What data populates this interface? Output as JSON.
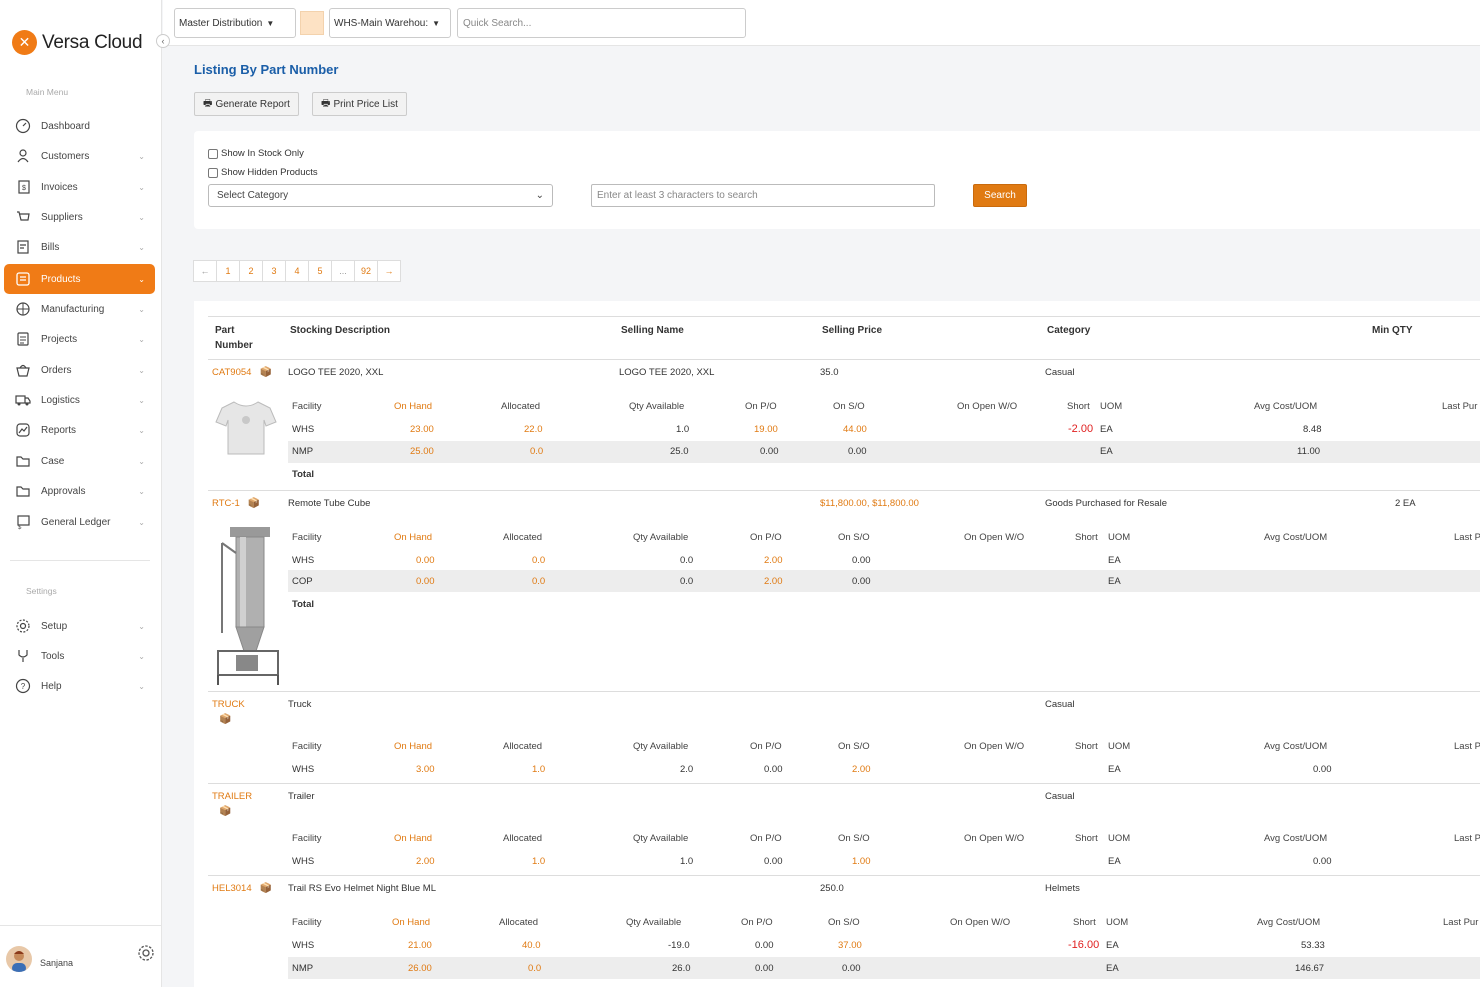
{
  "brand": {
    "name": "Versa Cloud"
  },
  "sidebar": {
    "main_heading": "Main Menu",
    "items": [
      {
        "label": "Dashboard"
      },
      {
        "label": "Customers"
      },
      {
        "label": "Invoices"
      },
      {
        "label": "Suppliers"
      },
      {
        "label": "Bills"
      },
      {
        "label": "Products"
      },
      {
        "label": "Manufacturing"
      },
      {
        "label": "Projects"
      },
      {
        "label": "Orders"
      },
      {
        "label": "Logistics"
      },
      {
        "label": "Reports"
      },
      {
        "label": "Case"
      },
      {
        "label": "Approvals"
      },
      {
        "label": "General Ledger"
      }
    ],
    "settings_heading": "Settings",
    "settings_items": [
      {
        "label": "Setup"
      },
      {
        "label": "Tools"
      },
      {
        "label": "Help"
      }
    ],
    "user": {
      "name": "Sanjana"
    }
  },
  "topbar": {
    "company": "Master Distribution",
    "warehouse": "WHS-Main Warehou:",
    "quick_search_placeholder": "Quick Search..."
  },
  "page": {
    "title": "Listing By Part Number",
    "generate_report": "Generate Report",
    "print_price_list": "Print Price List"
  },
  "filters": {
    "show_in_stock": "Show In Stock Only",
    "show_hidden": "Show Hidden Products",
    "category_placeholder": "Select Category",
    "search_placeholder": "Enter at least 3 characters to search",
    "search_button": "Search"
  },
  "pager": [
    "←",
    "1",
    "2",
    "3",
    "4",
    "5",
    "...",
    "92",
    "→"
  ],
  "columns": {
    "part_number_1": "Part",
    "part_number_2": "Number",
    "stocking_description": "Stocking Description",
    "selling_name": "Selling Name",
    "selling_price": "Selling Price",
    "category": "Category",
    "min_qty": "Min QTY"
  },
  "inv_columns": {
    "facility": "Facility",
    "on_hand": "On Hand",
    "allocated": "Allocated",
    "qty_available": "Qty Available",
    "on_po": "On P/O",
    "on_so": "On S/O",
    "on_open_wo": "On Open W/O",
    "short": "Short",
    "uom": "UOM",
    "avg_cost": "Avg Cost/UOM",
    "last_pur": "Last Pur",
    "last_p": "Last P",
    "total": "Total"
  },
  "products": [
    {
      "part": "CAT9054",
      "desc": "LOGO TEE 2020, XXL",
      "selling_name": "LOGO TEE 2020, XXL",
      "price": "35.0",
      "category": "Casual",
      "min_qty": "",
      "rows": [
        {
          "facility": "WHS",
          "on_hand": "23.00",
          "allocated": "22.0",
          "qty": "1.0",
          "po": "19.00",
          "so": "44.00",
          "short": "-2.00",
          "uom": "EA",
          "avg": "8.48"
        },
        {
          "facility": "NMP",
          "on_hand": "25.00",
          "allocated": "0.0",
          "qty": "25.0",
          "po": "0.00",
          "so": "0.00",
          "short": "",
          "uom": "EA",
          "avg": "11.00"
        }
      ]
    },
    {
      "part": "RTC-1",
      "desc": "Remote Tube Cube",
      "selling_name": "",
      "price": "$11,800.00, $11,800.00",
      "category": "Goods Purchased for Resale",
      "min_qty": "2 EA",
      "rows": [
        {
          "facility": "WHS",
          "on_hand": "0.00",
          "allocated": "0.0",
          "qty": "0.0",
          "po": "2.00",
          "so": "0.00",
          "short": "",
          "uom": "EA",
          "avg": ""
        },
        {
          "facility": "COP",
          "on_hand": "0.00",
          "allocated": "0.0",
          "qty": "0.0",
          "po": "2.00",
          "so": "0.00",
          "short": "",
          "uom": "EA",
          "avg": ""
        }
      ]
    },
    {
      "part": "TRUCK",
      "desc": "Truck",
      "selling_name": "",
      "price": "",
      "category": "Casual",
      "min_qty": "",
      "rows": [
        {
          "facility": "WHS",
          "on_hand": "3.00",
          "allocated": "1.0",
          "qty": "2.0",
          "po": "0.00",
          "so": "2.00",
          "short": "",
          "uom": "EA",
          "avg": "0.00"
        }
      ]
    },
    {
      "part": "TRAILER",
      "desc": "Trailer",
      "selling_name": "",
      "price": "",
      "category": "Casual",
      "min_qty": "",
      "rows": [
        {
          "facility": "WHS",
          "on_hand": "2.00",
          "allocated": "1.0",
          "qty": "1.0",
          "po": "0.00",
          "so": "1.00",
          "short": "",
          "uom": "EA",
          "avg": "0.00"
        }
      ]
    },
    {
      "part": "HEL3014",
      "desc": "Trail RS Evo Helmet Night Blue ML",
      "selling_name": "",
      "price": "250.0",
      "category": "Helmets",
      "min_qty": "",
      "rows": [
        {
          "facility": "WHS",
          "on_hand": "21.00",
          "allocated": "40.0",
          "qty": "-19.0",
          "po": "0.00",
          "so": "37.00",
          "short": "-16.00",
          "uom": "EA",
          "avg": "53.33"
        },
        {
          "facility": "NMP",
          "on_hand": "26.00",
          "allocated": "0.0",
          "qty": "26.0",
          "po": "0.00",
          "so": "0.00",
          "short": "",
          "uom": "EA",
          "avg": "146.67"
        }
      ]
    }
  ],
  "colors": {
    "accent": "#f07b16",
    "title_blue": "#1a5ea8",
    "negative": "#e02020"
  },
  "icons": [
    "dashboard-icon",
    "customers-icon",
    "invoices-icon",
    "suppliers-icon",
    "bills-icon",
    "products-icon",
    "manufacturing-icon",
    "projects-icon",
    "orders-icon",
    "logistics-icon",
    "reports-icon",
    "case-icon",
    "approvals-icon",
    "general-ledger-icon",
    "setup-icon",
    "tools-icon",
    "help-icon",
    "gear-icon",
    "box-icon",
    "printer-icon"
  ]
}
